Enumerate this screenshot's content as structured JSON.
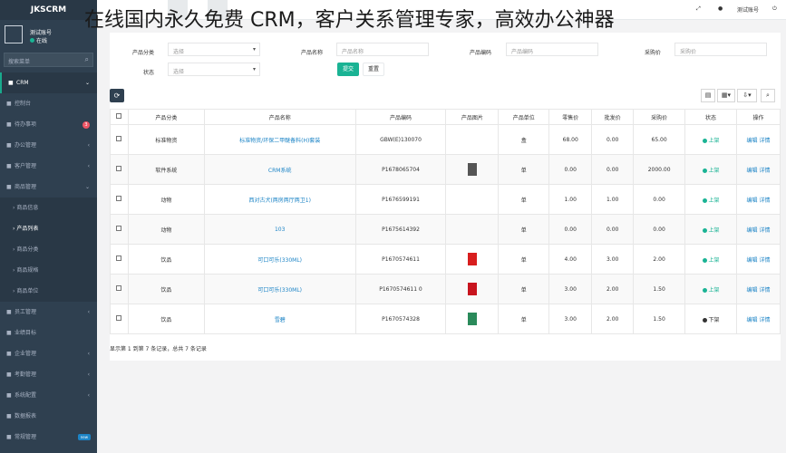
{
  "app": {
    "logo": "JKSCRM",
    "user_name": "测试账号",
    "user_status": "在线",
    "search_placeholder": "搜索菜单"
  },
  "overlay": {
    "slogan": "在线国内永久免费 CRM，客户关系管理专家，高效办公神器"
  },
  "topbar": {
    "right_label": "测试账号"
  },
  "sidebar": {
    "items": [
      {
        "label": "CRM",
        "icon": "home-icon",
        "active": true,
        "arrow": "⌄"
      },
      {
        "label": "控制台",
        "icon": "dashboard-icon"
      },
      {
        "label": "待办事项",
        "icon": "todo-icon",
        "badge": "3"
      },
      {
        "label": "办公管理",
        "icon": "office-icon",
        "arrow": "‹"
      },
      {
        "label": "客户管理",
        "icon": "customer-icon",
        "arrow": "‹"
      },
      {
        "label": "商品管理",
        "icon": "product-icon",
        "arrow": "⌄",
        "open": true
      }
    ],
    "sub_items": [
      {
        "label": "商品信息"
      },
      {
        "label": "产品列表",
        "active": true
      },
      {
        "label": "商品分类"
      },
      {
        "label": "商品规格"
      },
      {
        "label": "商品单位"
      }
    ],
    "items2": [
      {
        "label": "员工管理",
        "icon": "staff-icon",
        "arrow": "‹"
      },
      {
        "label": "业绩目标",
        "icon": "target-icon"
      },
      {
        "label": "企业管理",
        "icon": "company-icon",
        "arrow": "‹"
      },
      {
        "label": "考勤管理",
        "icon": "attendance-icon",
        "arrow": "‹"
      },
      {
        "label": "系统配置",
        "icon": "settings-icon",
        "arrow": "‹"
      },
      {
        "label": "数据报表",
        "icon": "report-icon"
      },
      {
        "label": "常规管理",
        "icon": "manage-icon",
        "badge_new": "new"
      }
    ]
  },
  "filter": {
    "category_label": "产品分类",
    "category_value": "选择",
    "name_label": "产品名称",
    "name_placeholder": "产品名称",
    "code_label": "产品编码",
    "code_placeholder": "产品编码",
    "price_label": "采购价",
    "price_placeholder": "采购价",
    "status_label": "状态",
    "status_value": "选择",
    "search_button": "提交",
    "reset_button": "重置"
  },
  "table": {
    "headers": [
      "产品分类",
      "产品名称",
      "产品编码",
      "产品图片",
      "产品单位",
      "零售价",
      "批发价",
      "采购价",
      "状态",
      "操作"
    ],
    "rows": [
      {
        "category": "标准物资",
        "name": "标准物资/环保二甲醚备料(H)套装",
        "code": "GBW(E)130070",
        "image": "",
        "unit": "盒",
        "retail": "68.00",
        "wholesale": "0.00",
        "purchase": "65.00",
        "status": "上架",
        "status_color": "#1ab394",
        "ops": "编辑 详情"
      },
      {
        "category": "软件系统",
        "name": "CRM系统",
        "code": "P1678065704",
        "image": "photo",
        "unit": "单",
        "retail": "0.00",
        "wholesale": "0.00",
        "purchase": "2000.00",
        "status": "上架",
        "status_color": "#1ab394",
        "ops": "编辑 详情"
      },
      {
        "category": "动物",
        "name": "西对古犬(两房两厅两卫1)",
        "code": "P1676599191",
        "image": "",
        "unit": "单",
        "retail": "1.00",
        "wholesale": "1.00",
        "purchase": "0.00",
        "status": "上架",
        "status_color": "#1ab394",
        "ops": "编辑 详情"
      },
      {
        "category": "动物",
        "name": "103",
        "code": "P1675614392",
        "image": "",
        "unit": "单",
        "retail": "0.00",
        "wholesale": "0.00",
        "purchase": "0.00",
        "status": "上架",
        "status_color": "#1ab394",
        "ops": "编辑 详情"
      },
      {
        "category": "饮品",
        "name": "可口可乐(330ML)",
        "code": "P1670574611",
        "image": "red-can",
        "unit": "单",
        "retail": "4.00",
        "wholesale": "3.00",
        "purchase": "2.00",
        "status": "上架",
        "status_color": "#1ab394",
        "ops": "编辑 详情"
      },
      {
        "category": "饮品",
        "name": "可口可乐(330ML)",
        "code": "P1670574611 0",
        "image": "red-cup",
        "unit": "单",
        "retail": "3.00",
        "wholesale": "2.00",
        "purchase": "1.50",
        "status": "上架",
        "status_color": "#1ab394",
        "ops": "编辑 详情"
      },
      {
        "category": "饮品",
        "name": "雪碧",
        "code": "P1670574328",
        "image": "green-can",
        "unit": "单",
        "retail": "3.00",
        "wholesale": "2.00",
        "purchase": "1.50",
        "status": "下架",
        "status_color": "#333333",
        "ops": "编辑 详情"
      }
    ],
    "pager": "显示第 1 到第 7 条记录，总共 7 条记录"
  }
}
